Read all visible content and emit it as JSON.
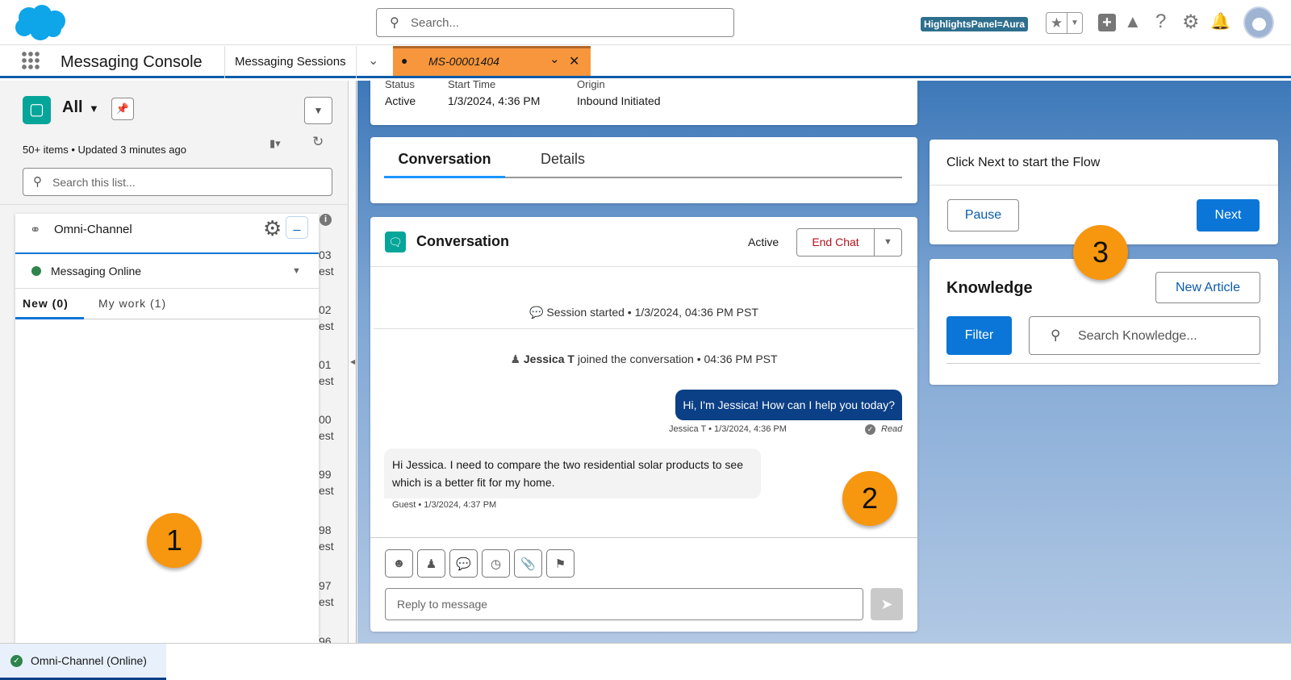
{
  "header": {
    "search_placeholder": "Search...",
    "badge": "HighlightsPanel=Aura"
  },
  "nav": {
    "app_name": "Messaging Console",
    "object_tab": "Messaging Sessions",
    "record_tab": "MS-00001404",
    "accent": "#f7963c"
  },
  "list": {
    "view_name": "All",
    "meta": "50+ items • Updated 3 minutes ago",
    "search_placeholder": "Search this list...",
    "row_fragments": [
      {
        "a": "03",
        "b": "est"
      },
      {
        "a": "02",
        "b": "est"
      },
      {
        "a": "01",
        "b": "est"
      },
      {
        "a": "00",
        "b": "est"
      },
      {
        "a": "99",
        "b": "est"
      },
      {
        "a": "98",
        "b": "est"
      },
      {
        "a": "97",
        "b": "est"
      },
      {
        "a": "96",
        "b": ""
      }
    ]
  },
  "omni": {
    "title": "Omni-Channel",
    "status": "Messaging Online",
    "status_color": "#2e844a",
    "tabs": [
      {
        "label": "New (0)"
      },
      {
        "label": "My work (1)"
      }
    ]
  },
  "highlights": {
    "fields": [
      {
        "label": "Status",
        "value": "Active"
      },
      {
        "label": "Start Time",
        "value": "1/3/2024, 4:36 PM"
      },
      {
        "label": "Origin",
        "value": "Inbound Initiated"
      }
    ]
  },
  "tabs": [
    {
      "label": "Conversation"
    },
    {
      "label": "Details"
    }
  ],
  "conversation": {
    "title": "Conversation",
    "status": "Active",
    "end_chat": "End Chat",
    "session_started": "Session started • 1/3/2024, 04:36 PM PST",
    "joined_name": "Jessica T",
    "joined_text": " joined the conversation • 04:36 PM PST",
    "agent_message": "Hi, I'm Jessica! How can I help you today?",
    "agent_meta": "Jessica T • 1/3/2024, 4:36 PM",
    "read": "Read",
    "guest_message": "Hi Jessica. I need to compare the two residential solar products to see which is a better fit for my home.",
    "guest_meta": "Guest • 1/3/2024, 4:37 PM",
    "reply_placeholder": "Reply to message"
  },
  "flow": {
    "text": "Click Next to start the Flow",
    "pause": "Pause",
    "next": "Next"
  },
  "knowledge": {
    "title": "Knowledge",
    "new_article": "New Article",
    "filter": "Filter",
    "search_placeholder": "Search Knowledge..."
  },
  "callouts": [
    "1",
    "2",
    "3"
  ],
  "utility": {
    "omni": "Omni-Channel (Online)"
  }
}
